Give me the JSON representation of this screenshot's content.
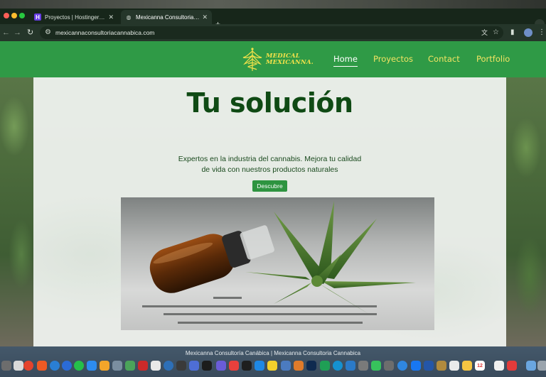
{
  "browser": {
    "tabs": [
      {
        "title": "Proyectos | Hostinger Website",
        "active": false
      },
      {
        "title": "Mexicanna Consultoria Canábica",
        "active": true
      }
    ],
    "new_tab": "+",
    "url": "mexicannaconsultoriacannabica.com"
  },
  "site": {
    "logo": {
      "line1": "MEDICAL",
      "line2": "MEXICANNA."
    },
    "nav": [
      "Home",
      "Proyectos",
      "Contact",
      "Portfolio"
    ],
    "active_nav": "Home",
    "hero": {
      "title": "Tu solución",
      "text_line1": "Expertos en la industria del cannabis. Mejora tu calidad",
      "text_line2": "de vida con nuestros productos naturales",
      "button": "Descubre"
    },
    "colors": {
      "header": "#2f9a46",
      "nav_text": "#f3e463",
      "title": "#0f4a14",
      "button": "#2e9440"
    }
  },
  "dock": {
    "window_title": "Mexicanna Consultoría Canábica | Mexicanna Consultoria Cannabica",
    "calendar_day": "12"
  }
}
